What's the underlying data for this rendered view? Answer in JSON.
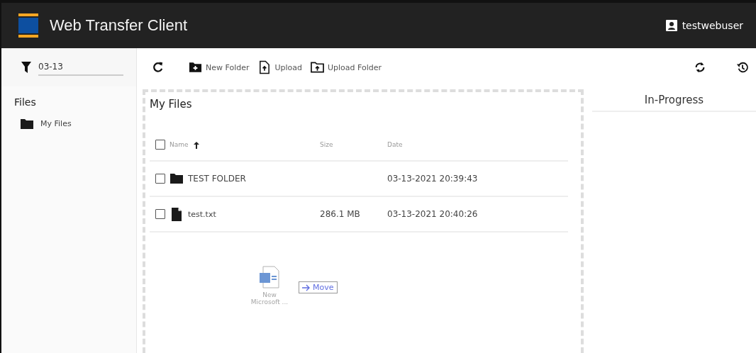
{
  "header": {
    "title": "Web Transfer Client",
    "user": "testwebuser"
  },
  "filter": {
    "value": "03-13"
  },
  "toolbar": {
    "buttons": [
      {
        "kind": "refresh"
      },
      {
        "kind": "new-folder",
        "label": "New Folder"
      },
      {
        "kind": "upload",
        "label": "Upload"
      },
      {
        "kind": "upload-folder",
        "label": "Upload Folder"
      }
    ]
  },
  "sidebar": {
    "title": "Files",
    "items": [
      {
        "label": "My Files"
      }
    ]
  },
  "main": {
    "title": "My Files",
    "columns": [
      {
        "label": "Name",
        "sorted": true
      },
      {
        "label": "Size",
        "sorted": false
      },
      {
        "label": "Date",
        "sorted": false
      }
    ],
    "rows": [
      {
        "kind": "folder",
        "name": "TEST FOLDER",
        "date": "03-13-2021 20:39:43",
        "checked": false
      },
      {
        "kind": "file",
        "name": "test.txt",
        "size": "286.1 MB",
        "date": "03-13-2021 20:40:26",
        "checked": false
      }
    ],
    "header_checked": false
  },
  "drag": {
    "file_label": "New Microsoft ...",
    "action": "Move"
  },
  "progress": {
    "title": "In-Progress"
  }
}
